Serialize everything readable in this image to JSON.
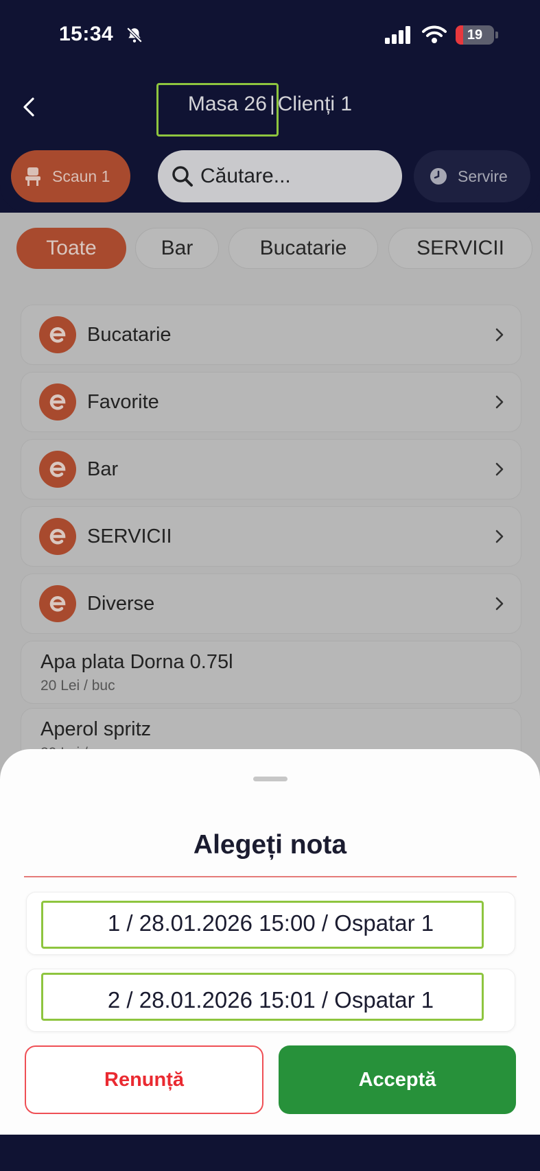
{
  "status_bar": {
    "time": "15:34",
    "battery_level": "19",
    "battery_fraction": 0.19
  },
  "header": {
    "table": "Masa 26",
    "separator": "|",
    "clients": "Clienți 1",
    "seat_label": "Scaun 1",
    "search_placeholder": "Căutare...",
    "serve_label": "Servire"
  },
  "filter_chips": [
    {
      "label": "Toate",
      "active": true
    },
    {
      "label": "Bar",
      "active": false
    },
    {
      "label": "Bucatarie",
      "active": false
    },
    {
      "label": "SERVICII",
      "active": false
    }
  ],
  "categories": [
    {
      "label": "Bucatarie"
    },
    {
      "label": "Favorite"
    },
    {
      "label": "Bar"
    },
    {
      "label": "SERVICII"
    },
    {
      "label": "Diverse"
    }
  ],
  "products": [
    {
      "name": "Apa plata Dorna 0.75l",
      "price": "20 Lei / buc"
    },
    {
      "name": "Aperol spritz",
      "price": "20 Lei / pa"
    }
  ],
  "sheet": {
    "title": "Alegeți nota",
    "options": [
      "1 / 28.01.2026 15:00 / Ospatar 1",
      "2 / 28.01.2026 15:01 / Ospatar 1"
    ],
    "cancel_label": "Renunță",
    "accept_label": "Acceptă"
  },
  "colors": {
    "navy": "#101333",
    "accent_orange": "#a84a2e",
    "accept_green": "#27913a",
    "cancel_red": "#ea2a31",
    "highlight_green": "#8ec53f"
  },
  "icons": [
    "back-chevron-icon",
    "bell-slash-icon",
    "signal-icon",
    "wifi-icon",
    "battery-icon",
    "seat-icon",
    "search-icon",
    "clock-icon",
    "e-logo-icon",
    "chevron-right-icon"
  ]
}
